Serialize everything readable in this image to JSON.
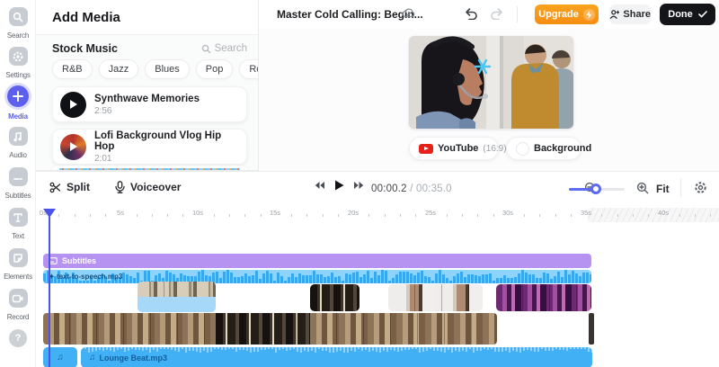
{
  "sidebar": {
    "items": [
      {
        "label": "Search",
        "active": false
      },
      {
        "label": "Settings",
        "active": false
      },
      {
        "label": "Media",
        "active": true
      },
      {
        "label": "Audio",
        "active": false
      },
      {
        "label": "Subtitles",
        "active": false
      },
      {
        "label": "Text",
        "active": false
      },
      {
        "label": "Elements",
        "active": false
      },
      {
        "label": "Record",
        "active": false
      }
    ],
    "help": "?"
  },
  "media_panel": {
    "title": "Add Media",
    "section_title": "Stock Music",
    "search_label": "Search",
    "genres": [
      "R&B",
      "Jazz",
      "Blues",
      "Pop",
      "Rock"
    ],
    "more": "⋯",
    "tracks": [
      {
        "title": "Synthwave Memories",
        "duration": "2:56"
      },
      {
        "title": "Lofi Background Vlog Hip Hop",
        "duration": "2:01"
      }
    ]
  },
  "header": {
    "project_title": "Master Cold Calling: Begin...",
    "upgrade_label": "Upgrade",
    "share_label": "Share",
    "done_label": "Done"
  },
  "preview": {
    "platform": "YouTube",
    "aspect_ratio": "(16:9)",
    "background_label": "Background"
  },
  "timeline": {
    "split_label": "Split",
    "voiceover_label": "Voiceover",
    "current_time": "00:00.2",
    "time_separator": "/",
    "total_time": "00:35.0",
    "fit_label": "Fit",
    "ruler": [
      "0s",
      "5s",
      "10s",
      "15s",
      "20s",
      "25s",
      "30s",
      "35s",
      "40s"
    ],
    "subtitles_clip_label": "Subtitles",
    "speech_clip_label": "text-to-speech.mp3",
    "speech_clip_prefix": "✦",
    "music_clip_label": "Lounge Beat.mp3"
  },
  "colors": {
    "accent": "#5d5fef",
    "upgrade_orange": "#f79b16",
    "track_blue": "#42b0f5",
    "subtitle_purple": "#b793f1",
    "playhead": "#4b53e8"
  }
}
